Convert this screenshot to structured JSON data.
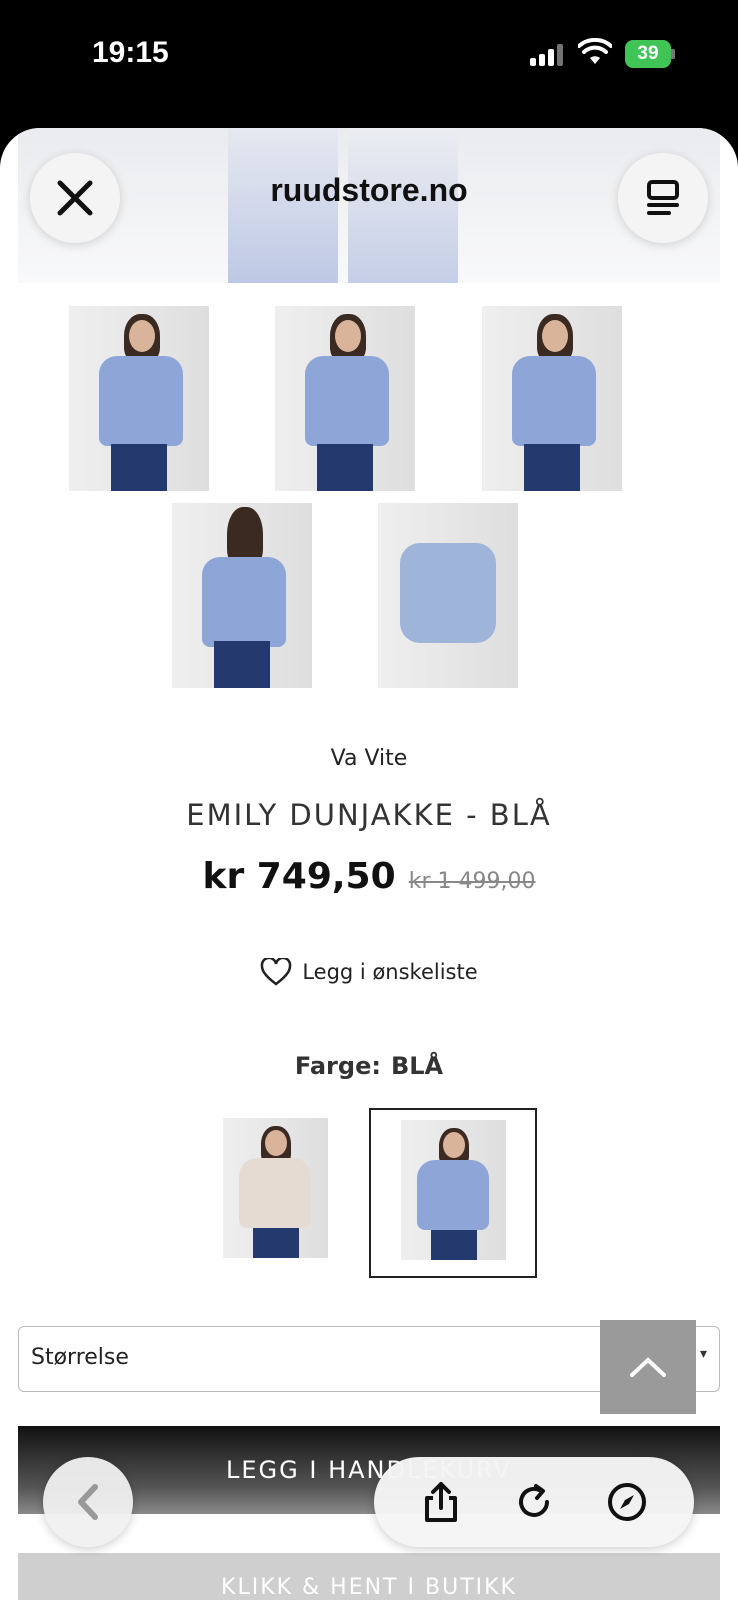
{
  "status_bar": {
    "time": "19:15",
    "battery": "39"
  },
  "browser": {
    "site_title": "ruudstore.no"
  },
  "product": {
    "brand": "Va Vite",
    "name": "EMILY DUNJAKKE - BLÅ",
    "price": "kr 749,50",
    "old_price": "kr 1 499,00",
    "wishlist_label": "Legg i ønskeliste",
    "color_label": "Farge:",
    "color_value": "BLÅ",
    "size_placeholder": "Størrelse",
    "add_to_cart_label": "LEGG I HANDLEKURV",
    "pickup_label": "KLIKK & HENT I BUTIKK"
  },
  "colors": {
    "jacket_blue": "#8ea5d8",
    "jacket_beige": "#e6dbd2",
    "jeans": "#243a6e",
    "accent_green": "#3fc455"
  }
}
